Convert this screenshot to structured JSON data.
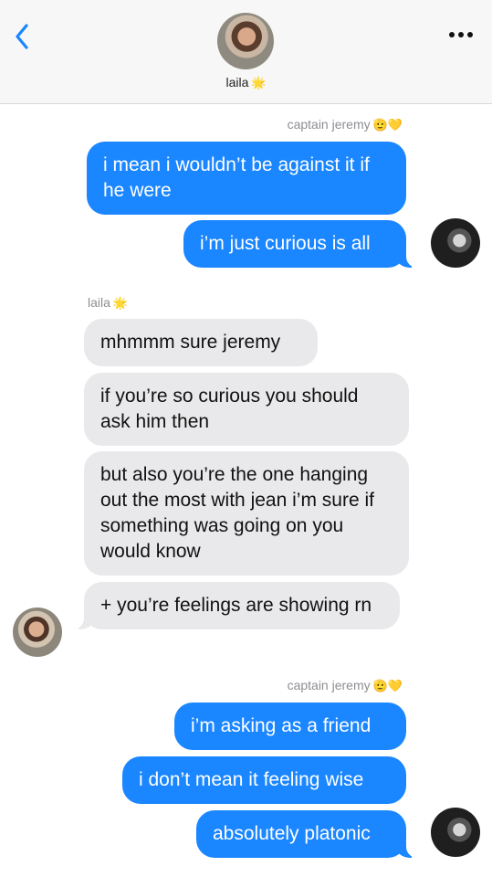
{
  "header": {
    "contact_name": "laila",
    "contact_emoji": "🌟",
    "back_icon": "chevron-left-icon",
    "more_icon": "more-dots-icon"
  },
  "messages": {
    "sender_jeremy_1": "captain jeremy",
    "sender_jeremy_emoji": "🫡💛",
    "out_1": "i mean i wouldn’t be against it if he were",
    "out_2": "i’m just curious is all",
    "sender_laila": "laila",
    "sender_laila_emoji": "🌟",
    "in_1": "mhmmm sure jeremy",
    "in_2": "if you’re so curious you should ask him then",
    "in_3": "but also you’re the one hanging out the most with jean i’m sure if something was going on you would know",
    "in_4": "+ you’re feelings are showing rn",
    "sender_jeremy_2": "captain jeremy",
    "out_3": "i’m asking as a friend",
    "out_4": "i don’t mean it feeling wise",
    "out_5": "absolutely platonic"
  },
  "colors": {
    "outgoing_bubble": "#1a86ff",
    "incoming_bubble": "#e9e9eb",
    "accent": "#1a86ff"
  }
}
